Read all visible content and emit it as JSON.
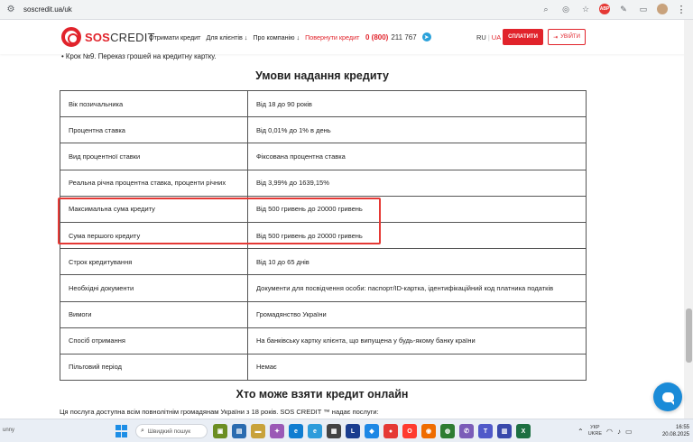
{
  "browser": {
    "url": "soscredit.ua/uk"
  },
  "header": {
    "logo_sos": "SOS",
    "logo_credit": "CREDIT",
    "nav": [
      {
        "label": "Отримати кредит"
      },
      {
        "label": "Для клієнтів ↓"
      },
      {
        "label": "Про компанію ↓"
      },
      {
        "label": "Повернути кредит"
      }
    ],
    "phone_prefix": "0 (800)",
    "phone_number": "211 767",
    "lang_ru": "RU",
    "lang_sep": "|",
    "lang_ua": "UA",
    "pay_button": "СПЛАТИТИ",
    "login_button": "УВІЙТИ"
  },
  "content": {
    "step_line": "• Крок №9. Переказ грошей на кредитну картку.",
    "title_1": "Умови надання кредиту",
    "rows": [
      {
        "label": "Вік позичальника",
        "value": "Від 18 до 90 років"
      },
      {
        "label": "Процентна ставка",
        "value": "Від 0,01% до 1% в день"
      },
      {
        "label": "Вид процентної ставки",
        "value": "Фіксована процентна ставка"
      },
      {
        "label": "Реальна річна процентна ставка, проценти річних",
        "value": "Від 3,99% до 1639,15%"
      },
      {
        "label": "Максимальна сума кредиту",
        "value": "Від 500 гривень до 20000 гривень"
      },
      {
        "label": "Сума першого кредиту",
        "value": "Від 500 гривень до 20000 гривень"
      },
      {
        "label": "Строк кредитування",
        "value": "Від 10 до 65 днів"
      },
      {
        "label": "Необхідні документи",
        "value": "Документи для посвідчення особи: паспорт/ID-картка, ідентифікаційний код платника податків"
      },
      {
        "label": "Вимоги",
        "value": "Громадянство України"
      },
      {
        "label": "Спосіб отримання",
        "value": "На банківську картку клієнта, що випущена у будь-якому банку країни"
      },
      {
        "label": "Пільговий період",
        "value": "Немає"
      }
    ],
    "title_2": "Хто може взяти кредит онлайн",
    "bottom_line": "Ця послуга доступна всім повнолітнім громадянам України з 18 років. SOS CREDIT ™ надає послуги:"
  },
  "taskbar": {
    "left_text": "unny",
    "search_placeholder": "Швидкий пошук",
    "lang_line1": "УКР",
    "lang_line2": "UKRE",
    "time": "16:55",
    "date": "20.08.2025"
  },
  "colors": {
    "brand_red": "#e1232b",
    "highlight": "#e53935",
    "chat_blue": "#1a8bd8"
  }
}
